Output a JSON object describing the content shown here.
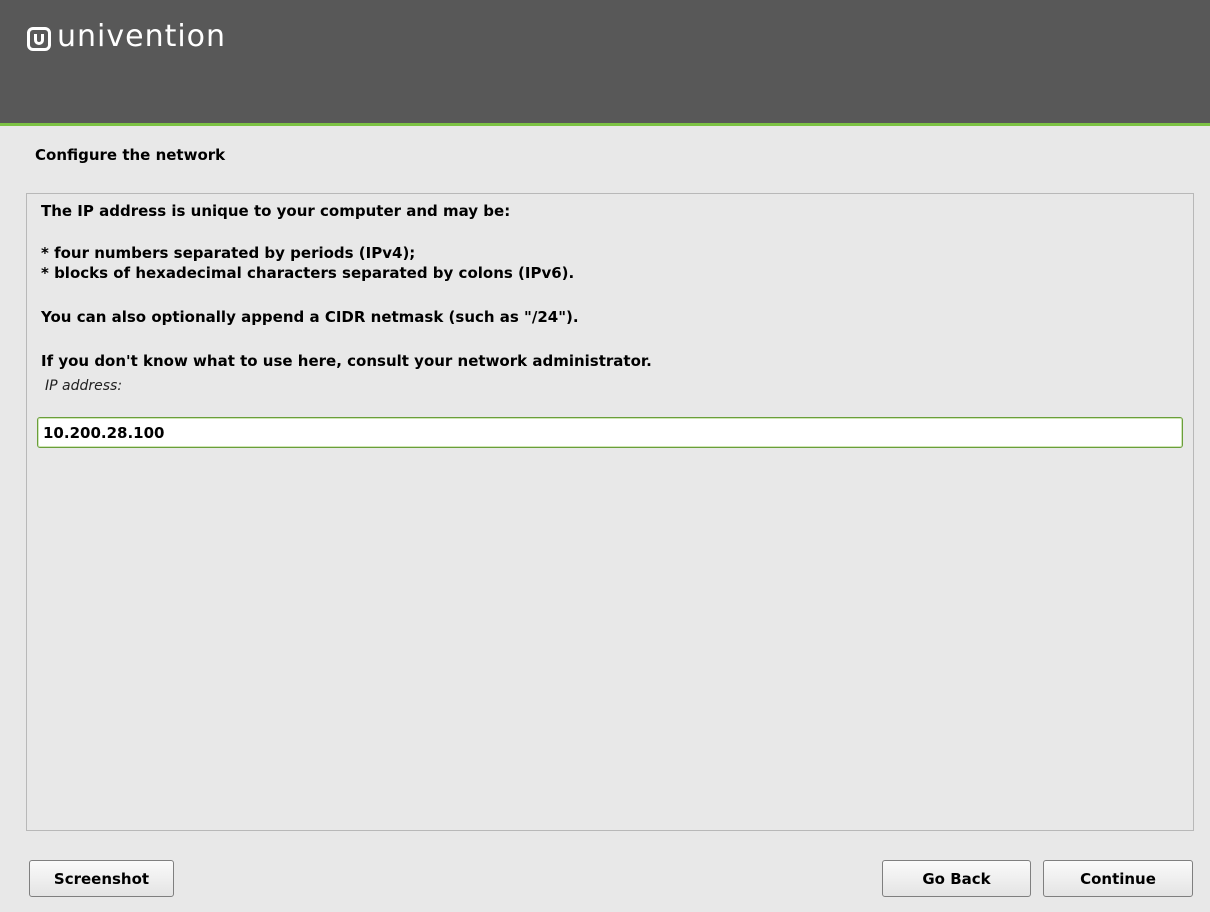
{
  "header": {
    "brand": "univention",
    "logo_icon": "univention-logo-icon",
    "accent_color": "#7cc243",
    "background_color": "#585858"
  },
  "step": {
    "title": "Configure the network"
  },
  "content": {
    "intro": "The IP address is unique to your computer and may be:",
    "bullet_1": " * four numbers separated by periods (IPv4);",
    "bullet_2": " * blocks of hexadecimal characters separated by colons (IPv6).",
    "cidr_note": "You can also optionally append a CIDR netmask (such as \"/24\").",
    "admin_note": "If you don't know what to use here, consult your network administrator."
  },
  "form": {
    "ip_label": "IP address:",
    "ip_value": "10.200.28.100"
  },
  "buttons": {
    "screenshot": "Screenshot",
    "go_back": "Go Back",
    "continue": "Continue"
  }
}
